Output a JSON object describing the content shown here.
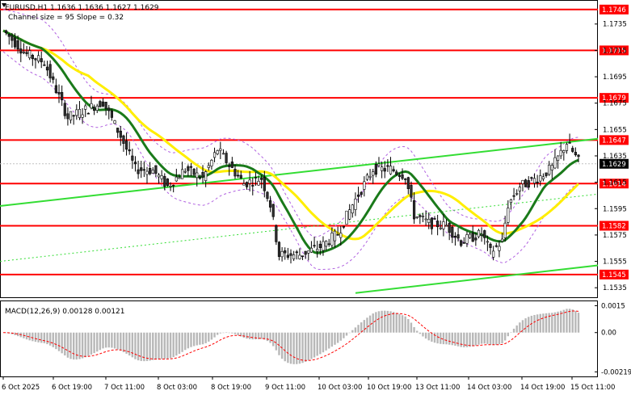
{
  "header": {
    "line1": "EURUSD,H1  1.1636 1.1636 1.1627 1.1629",
    "line2": "Channel size = 95 Slope = 0.32"
  },
  "macd": {
    "label": "MACD(12,26,9) 0.00128 0.00121"
  },
  "colors": {
    "bull": "#2f2f2f",
    "bear": "#2f2f2f",
    "level": "#ff0000",
    "ma_fast": "#1a7a1a",
    "ma_slow": "#ffee00",
    "channel": "#33dd33",
    "bands": "#b060e0",
    "macd_hist": "#b8b8b8",
    "macd_signal": "#ff0000"
  },
  "chart_data": {
    "type": "candlestick",
    "symbol": "EURUSD",
    "timeframe": "H1",
    "ylim": [
      1.1529,
      1.1752
    ],
    "y_ticks": [
      "1.1735",
      "1.1715",
      "1.1695",
      "1.1675",
      "1.1655",
      "1.1635",
      "1.1615",
      "1.1595",
      "1.1575",
      "1.1555",
      "1.1535"
    ],
    "x_ticks": [
      "6 Oct 2025",
      "6 Oct 19:00",
      "7 Oct 11:00",
      "8 Oct 03:00",
      "8 Oct 19:00",
      "9 Oct 11:00",
      "10 Oct 03:00",
      "10 Oct 19:00",
      "13 Oct 11:00",
      "14 Oct 03:00",
      "14 Oct 19:00",
      "15 Oct 11:00"
    ],
    "levels": [
      {
        "label": "1.1746",
        "value": 1.1746
      },
      {
        "label": "1.1715",
        "value": 1.1715
      },
      {
        "label": "1.1679",
        "value": 1.1679
      },
      {
        "label": "1.1647",
        "value": 1.1647
      },
      {
        "label": "1.1614",
        "value": 1.1614
      },
      {
        "label": "1.1582",
        "value": 1.1582
      },
      {
        "label": "1.1545",
        "value": 1.1545
      }
    ],
    "current_price": {
      "label": "1.1629",
      "value": 1.1629
    },
    "close_points": [
      [
        0,
        1.173
      ],
      [
        8,
        1.1712
      ],
      [
        14,
        1.1706
      ],
      [
        22,
        1.1664
      ],
      [
        26,
        1.1668
      ],
      [
        34,
        1.1676
      ],
      [
        40,
        1.165
      ],
      [
        45,
        1.1625
      ],
      [
        51,
        1.1624
      ],
      [
        56,
        1.1612
      ],
      [
        62,
        1.1625
      ],
      [
        68,
        1.1618
      ],
      [
        73,
        1.164
      ],
      [
        77,
        1.1628
      ],
      [
        82,
        1.1614
      ],
      [
        88,
        1.1618
      ],
      [
        91,
        1.1598
      ],
      [
        94,
        1.156
      ],
      [
        101,
        1.156
      ],
      [
        108,
        1.1566
      ],
      [
        114,
        1.1576
      ],
      [
        119,
        1.1598
      ],
      [
        126,
        1.1625
      ],
      [
        132,
        1.1625
      ],
      [
        137,
        1.162
      ],
      [
        140,
        1.159
      ],
      [
        145,
        1.1584
      ],
      [
        151,
        1.1582
      ],
      [
        156,
        1.157
      ],
      [
        163,
        1.1576
      ],
      [
        166,
        1.1562
      ],
      [
        170,
        1.157
      ],
      [
        172,
        1.1598
      ],
      [
        176,
        1.1612
      ],
      [
        182,
        1.1618
      ],
      [
        187,
        1.1626
      ],
      [
        192,
        1.1645
      ],
      [
        196,
        1.1631
      ]
    ],
    "macd": {
      "main": 0.00128,
      "signal": 0.00121,
      "y_ticks": [
        "0.0015",
        "0.00",
        "-0.00219"
      ]
    }
  }
}
